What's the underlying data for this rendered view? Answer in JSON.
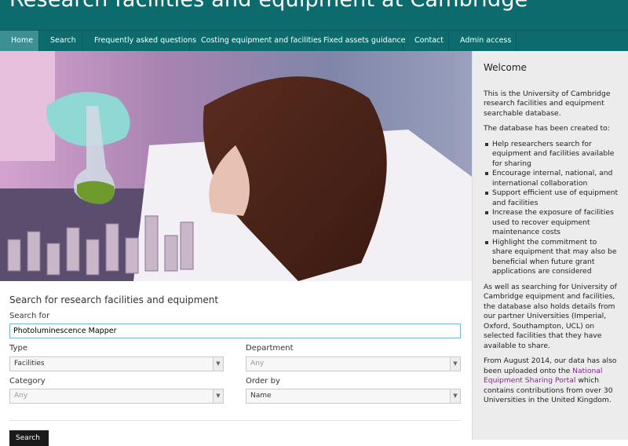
{
  "header": {
    "title": "Research facilities and equipment at Cambridge"
  },
  "nav": {
    "items": [
      "Home",
      "Search",
      "Frequently asked questions",
      "Costing equipment and facilities",
      "Fixed assets guidance",
      "Contact",
      "Admin access"
    ],
    "active": "Home"
  },
  "sidebar": {
    "title": "Welcome",
    "intro": "This is the University of Cambridge research facilities and equipment searchable database.",
    "created_to": "The database has been created to:",
    "bullets": [
      "Help researchers search for equipment and facilities available for sharing",
      "Encourage internal, national, and international collaboration",
      "Support efficient use of equipment and facilities",
      "Increase the exposure of facilities used to recover equipment maintenance costs",
      "Highlight the commitment to share equipment that may also be beneficial when future grant applications are considered"
    ],
    "partners": "As well as searching for University of Cambridge equipment and facilities, the database also holds details from our partner Universities (Imperial, Oxford, Southampton, UCL) on selected facilities that they have available to share.",
    "august_before": "From August 2014, our data has also been uploaded onto the",
    "portal_link": "National Equipment Sharing Portal",
    "august_after": "which contains contributions from over 30 Universities in the United Kingdom."
  },
  "search": {
    "heading": "Search for research facilities and equipment",
    "search_for_label": "Search for",
    "search_for_value": "Photoluminescence Mapper",
    "type_label": "Type",
    "type_value": "Facilities",
    "department_label": "Department",
    "department_value": "Any",
    "category_label": "Category",
    "category_value": "Any",
    "order_label": "Order by",
    "order_value": "Name",
    "button": "Search"
  },
  "colors": {
    "header_bg": "#0d6b6e",
    "nav_active": "#3c8f93",
    "link": "#7b2d86",
    "sidebar_bg": "#ececec"
  }
}
